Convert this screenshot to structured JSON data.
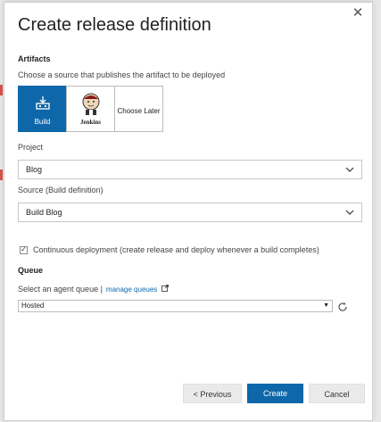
{
  "dialog": {
    "title": "Create release definition",
    "close_glyph": "✕"
  },
  "artifacts": {
    "heading": "Artifacts",
    "description": "Choose a source that publishes the artifact to be deployed",
    "tiles": [
      {
        "label": "Build",
        "icon": "build-icon",
        "selected": true
      },
      {
        "label": "Jenkins",
        "icon": "jenkins-icon",
        "selected": false
      },
      {
        "label": "Choose Later",
        "icon": "",
        "selected": false
      }
    ]
  },
  "project": {
    "label": "Project",
    "value": "Blog"
  },
  "source": {
    "label": "Source (Build definition)",
    "value": "Build Blog"
  },
  "continuous_deployment": {
    "checked": true,
    "label": "Continuous deployment (create release and deploy whenever a build completes)"
  },
  "queue": {
    "heading": "Queue",
    "label": "Select an agent queue |",
    "link_text": "manage queues",
    "selected_value": "Hosted"
  },
  "buttons": {
    "previous": "< Previous",
    "create": "Create",
    "cancel": "Cancel"
  },
  "colors": {
    "accent": "#0e67a9",
    "button_bg": "#eaeaea"
  }
}
